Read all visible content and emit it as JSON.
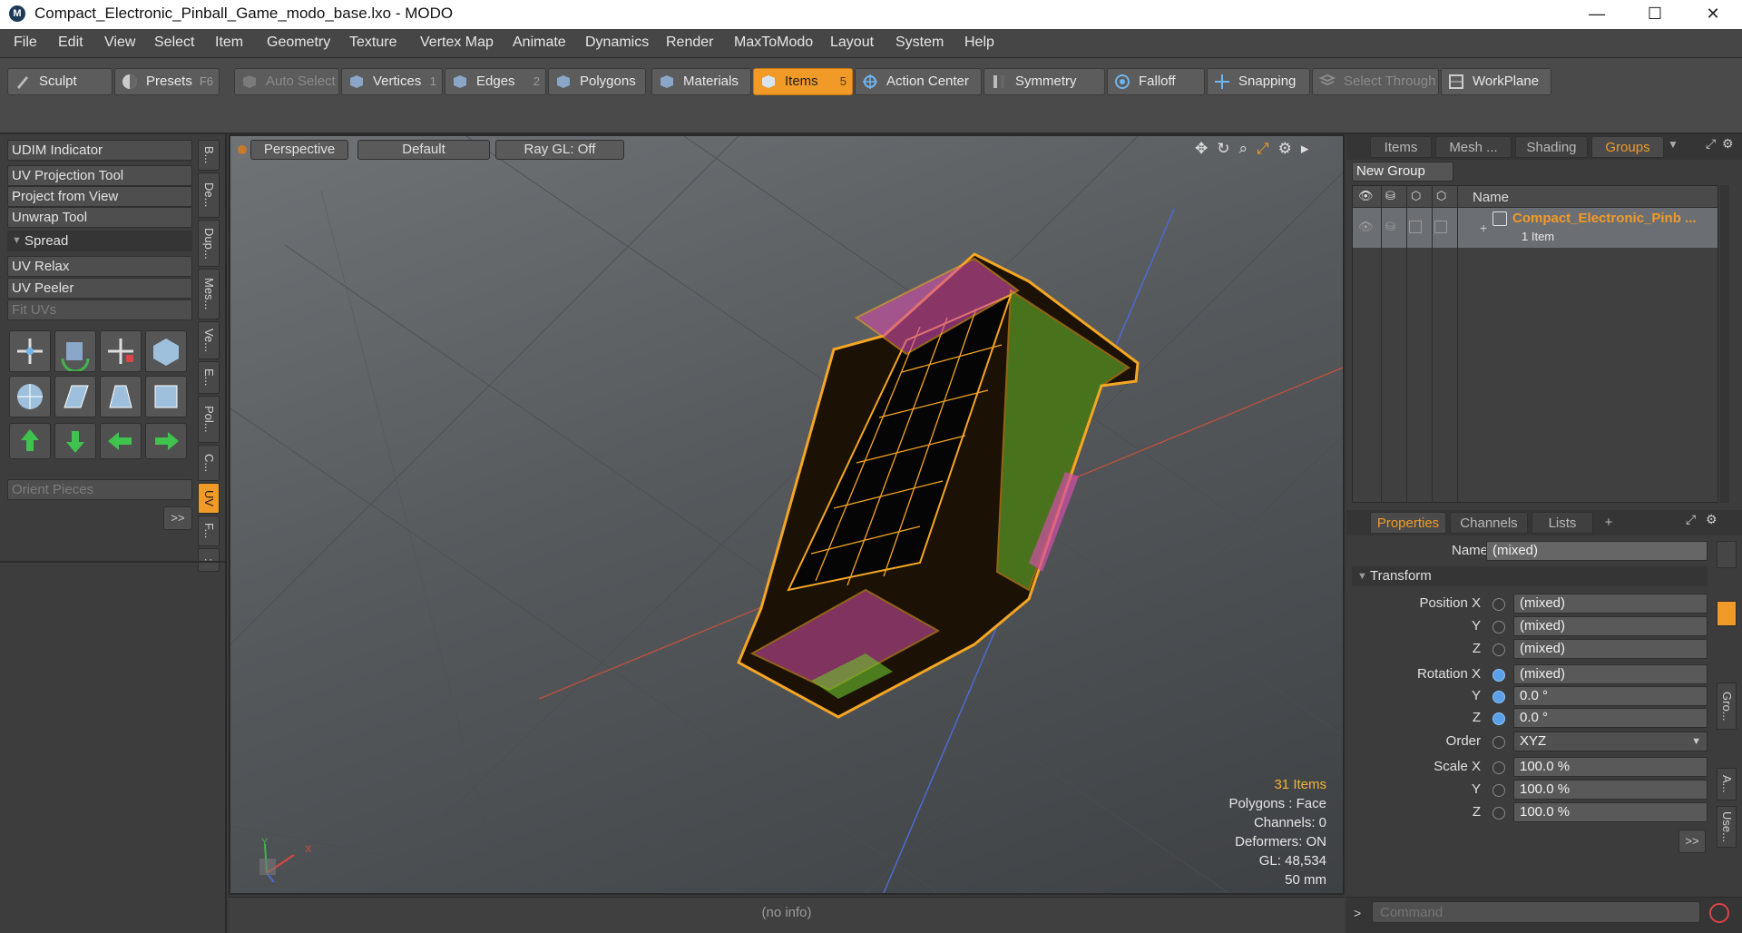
{
  "window": {
    "title": "Compact_Electronic_Pinball_Game_modo_base.lxo - MODO",
    "app_icon": "modo-logo-icon",
    "minimize": "—",
    "maximize": "☐",
    "close": "✕"
  },
  "menu": [
    "File",
    "Edit",
    "View",
    "Select",
    "Item",
    "Geometry",
    "Texture",
    "Vertex Map",
    "Animate",
    "Dynamics",
    "Render",
    "MaxToModo",
    "Layout",
    "System",
    "Help"
  ],
  "toolbar": {
    "sculpt": "Sculpt",
    "presets": "Presets",
    "presets_key": "F6",
    "auto_select": "Auto Select",
    "vertices": "Vertices",
    "vertices_key": "1",
    "edges": "Edges",
    "edges_key": "2",
    "polygons": "Polygons",
    "materials": "Materials",
    "items": "Items",
    "items_key": "5",
    "action_center": "Action Center",
    "symmetry": "Symmetry",
    "falloff": "Falloff",
    "snapping": "Snapping",
    "select_through": "Select Through",
    "workplane": "WorkPlane"
  },
  "left_panel": {
    "udim_indicator": "UDIM Indicator",
    "uv_projection_tool": "UV Projection Tool",
    "project_from_view": "Project from View",
    "unwrap_tool": "Unwrap Tool",
    "spread": "Spread",
    "uv_relax": "UV Relax",
    "uv_peeler": "UV Peeler",
    "fit_uvs": "Fit UVs",
    "orient_pieces": "Orient Pieces",
    "more": ">>",
    "vertical_tabs": [
      "B...",
      "De...",
      "Dup...",
      "Mes...",
      "Ve...",
      "E...",
      "Pol...",
      "C...",
      "UV",
      "F...",
      ":"
    ]
  },
  "viewport": {
    "perspective": "Perspective",
    "default": "Default",
    "raygl": "Ray GL: Off",
    "info": {
      "items": "31 Items",
      "polygons": "Polygons : Face",
      "channels": "Channels: 0",
      "deformers": "Deformers: ON",
      "gl": "GL: 48,534",
      "mm": "50 mm"
    },
    "axis_y": "Y",
    "axis_x": "X",
    "status": "(no info)"
  },
  "groups_panel": {
    "tabs": [
      "Items",
      "Mesh ...",
      "Shading",
      "Groups"
    ],
    "new_group": "New Group",
    "name_header": "Name",
    "group_name": "Compact_Electronic_Pinb ...",
    "group_count": "1 Item"
  },
  "properties_panel": {
    "tabs": [
      "Properties",
      "Channels",
      "Lists",
      "+"
    ],
    "name_label": "Name",
    "name_value": "(mixed)",
    "transform": "Transform",
    "position_x_label": "Position X",
    "position_x": "(mixed)",
    "position_y": "(mixed)",
    "position_z": "(mixed)",
    "rotation_x_label": "Rotation X",
    "rotation_x": "(mixed)",
    "rotation_y": "0.0 °",
    "rotation_z": "0.0 °",
    "order_label": "Order",
    "order_value": "XYZ",
    "scale_x_label": "Scale X",
    "scale_x": "100.0 %",
    "scale_y": "100.0 %",
    "scale_z": "100.0 %",
    "y": "Y",
    "z": "Z",
    "more": ">>",
    "side_tabs": [
      "Gro...",
      "A...",
      "Use..."
    ]
  },
  "command": {
    "prompt": ">",
    "placeholder": "Command"
  },
  "colors": {
    "accent": "#f29a27",
    "wireframe": "#f5a623"
  }
}
